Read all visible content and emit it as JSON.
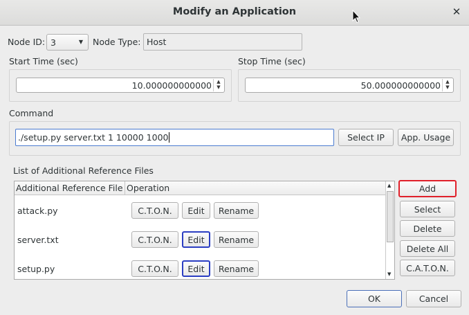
{
  "window": {
    "title": "Modify an Application",
    "close_glyph": "✕"
  },
  "node": {
    "id_label": "Node ID:",
    "id_value": "3",
    "type_label": "Node Type:",
    "type_value": "Host"
  },
  "start_time": {
    "label": "Start Time (sec)",
    "value": "10.000000000000"
  },
  "stop_time": {
    "label": "Stop Time (sec)",
    "value": "50.000000000000"
  },
  "command": {
    "label": "Command",
    "value": "./setup.py server.txt 1 10000 1000",
    "select_ip_label": "Select IP",
    "app_usage_label": "App. Usage"
  },
  "ref_files": {
    "label": "List of Additional Reference Files",
    "columns": [
      "Additional Reference File",
      "Operation"
    ],
    "rows": [
      {
        "file": "attack.py",
        "ops": [
          "C.T.O.N.",
          "Edit",
          "Rename"
        ]
      },
      {
        "file": "server.txt",
        "ops": [
          "C.T.O.N.",
          "Edit",
          "Rename"
        ]
      },
      {
        "file": "setup.py",
        "ops": [
          "C.T.O.N.",
          "Edit",
          "Rename"
        ]
      }
    ]
  },
  "side_buttons": {
    "add": "Add",
    "select": "Select",
    "delete": "Delete",
    "delete_all": "Delete All",
    "caton": "C.A.T.O.N."
  },
  "footer": {
    "ok": "OK",
    "cancel": "Cancel"
  },
  "icons": {
    "combo_arrow": "chevron-down-icon",
    "spin": "spin-arrows-icon",
    "close": "close-icon"
  }
}
